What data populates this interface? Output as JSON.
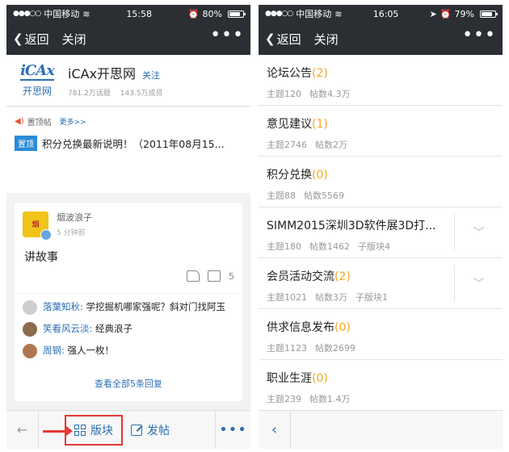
{
  "left": {
    "status": {
      "carrier": "中国移动",
      "time": "15:58",
      "battery": "80%",
      "battery_level": 0.8
    },
    "nav": {
      "back": "返回",
      "close": "关闭",
      "more": "•••"
    },
    "forum": {
      "logo_mark": "iCAx",
      "logo_sub": "开思网",
      "title": "iCAx开思网",
      "follow": "关注",
      "topics": "781.2万话题",
      "members": "143.5万成员"
    },
    "notice": {
      "label": "置顶帖",
      "more": "更多>>",
      "tag": "置顶",
      "text": "积分兑换最新说明！（2011年08月15..."
    },
    "post": {
      "author": "烟波浪子",
      "time": "5 分钟前",
      "title": "讲故事",
      "comment_count": "5",
      "replies": [
        {
          "name": "落葉知秋:",
          "text": " 学挖掘机哪家强呢？斜对门找阿玉",
          "color": "#cfcfcf"
        },
        {
          "name": "笑看风云淡:",
          "text": " 经典浪子",
          "color": "#8b6b4e"
        },
        {
          "name": "周钢:",
          "text": " 强人一枚！",
          "color": "#b07850"
        }
      ],
      "view_all": "查看全部5条回复"
    },
    "bottom": {
      "board": "版块",
      "post": "发帖",
      "more": "•••"
    }
  },
  "right": {
    "status": {
      "carrier": "中国移动",
      "time": "16:05",
      "battery": "79%",
      "battery_level": 0.79
    },
    "nav": {
      "back": "返回",
      "close": "关闭",
      "more": "•••"
    },
    "boards": [
      {
        "name": "论坛公告",
        "count": "(2)",
        "topics": "主题120",
        "posts": "帖数4.3万",
        "sub": "",
        "expand": false
      },
      {
        "name": "意见建议",
        "count": "(1)",
        "topics": "主题2746",
        "posts": "帖数2万",
        "sub": "",
        "expand": false
      },
      {
        "name": "积分兑换",
        "count": "(0)",
        "topics": "主题88",
        "posts": "帖数5569",
        "sub": "",
        "expand": false
      },
      {
        "name": "SIMM2015深圳3D软件展3D打...",
        "count": "",
        "topics": "主题180",
        "posts": "帖数1462",
        "sub": "子版块4",
        "expand": true
      },
      {
        "name": "会员活动交流",
        "count": "(2)",
        "topics": "主题1021",
        "posts": "帖数3万",
        "sub": "子版块1",
        "expand": true
      },
      {
        "name": "供求信息发布",
        "count": "(0)",
        "topics": "主题1123",
        "posts": "帖数2699",
        "sub": "",
        "expand": false
      },
      {
        "name": "职业生涯",
        "count": "(0)",
        "topics": "主题239",
        "posts": "帖数1.4万",
        "sub": "",
        "expand": false
      }
    ]
  }
}
